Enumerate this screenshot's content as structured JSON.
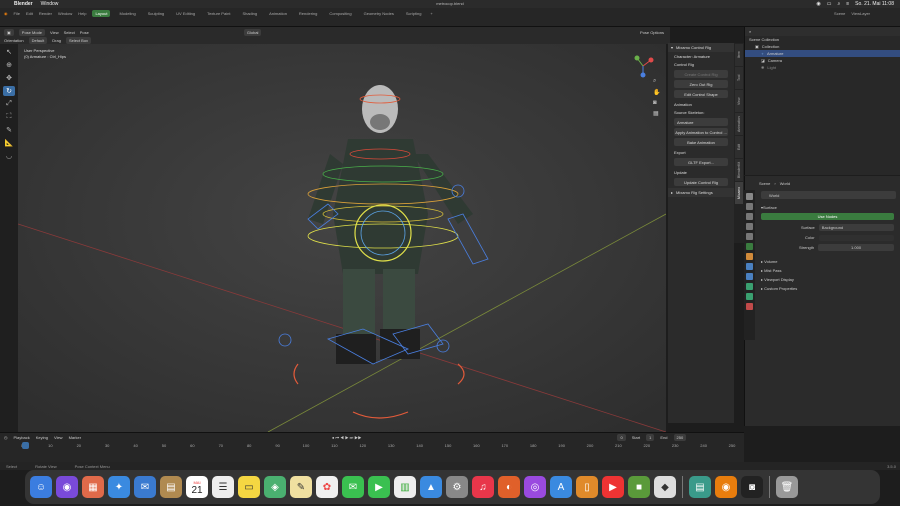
{
  "mac_menu": {
    "app": "Blender",
    "items": [
      "Window"
    ],
    "clock": "So. 21. Mai 11:08"
  },
  "file_title": "metrocop.blend",
  "topbar": {
    "menus": [
      "File",
      "Edit",
      "Render",
      "Window",
      "Help"
    ],
    "workspaces": [
      "Layout",
      "Modeling",
      "Sculpting",
      "UV Editing",
      "Texture Paint",
      "Shading",
      "Animation",
      "Rendering",
      "Compositing",
      "Geometry Nodes",
      "Scripting"
    ],
    "active_workspace": "Layout",
    "scene": "Scene",
    "view_layer": "ViewLayer"
  },
  "viewport_header": {
    "mode": "Pose Mode",
    "menus": [
      "View",
      "Select",
      "Pose"
    ],
    "orientation_label": "Orientation",
    "orientation": "Default",
    "drag_label": "Drag",
    "drag": "Select Box",
    "transform": "Global",
    "pose_options": "Pose Options"
  },
  "viewport_info": {
    "line1": "User Perspective",
    "line2": "(0) Armature : Ctrl_Hips"
  },
  "npanel": {
    "title": "Mixamo Control Rig",
    "character": "Character: Armature",
    "control_rig": "Control Rig",
    "create_rig": "Create Control Rig",
    "zero_out": "Zero Out Rig",
    "edit_shape": "Edit Control Shape",
    "animation": "Animation",
    "source_label": "Source Skeleton:",
    "source": "Armature",
    "apply_anim": "Apply Animation to Control ...",
    "bake_anim": "Bake Animation",
    "export": "Export",
    "gltf": "GLTF Export...",
    "update": "Update",
    "update_rig": "Update Control Rig",
    "settings": "Mixamo Rig Settings"
  },
  "side_tabs": [
    "Item",
    "Tool",
    "View",
    "Animation",
    "Edit",
    "BlenderKit",
    "Mixamo"
  ],
  "outliner": {
    "header": "Scene Collection",
    "rows": [
      {
        "name": "Collection",
        "indent": 1
      },
      {
        "name": "Armature",
        "indent": 2,
        "selected": true
      },
      {
        "name": "Camera",
        "indent": 2
      },
      {
        "name": "Light",
        "indent": 2
      }
    ]
  },
  "properties": {
    "scene": "Scene",
    "world_crumb": "World",
    "world": "World",
    "section": "Surface",
    "use_nodes": "Use Nodes",
    "surface_label": "Surface",
    "surface_value": "Background",
    "color_label": "Color",
    "strength_label": "Strength",
    "strength_value": "1.000",
    "panels": [
      "Volume",
      "Mist Pass",
      "Viewport Display",
      "Custom Properties"
    ]
  },
  "timeline": {
    "menus": [
      "Playback",
      "Keying",
      "View",
      "Marker"
    ],
    "frame": "0",
    "start_label": "Start",
    "start": "1",
    "end_label": "End",
    "end": "250",
    "ticks": [
      "0",
      "10",
      "20",
      "30",
      "40",
      "50",
      "60",
      "70",
      "80",
      "90",
      "100",
      "110",
      "120",
      "130",
      "140",
      "150",
      "160",
      "170",
      "180",
      "190",
      "200",
      "210",
      "220",
      "230",
      "240",
      "250"
    ]
  },
  "statusbar": {
    "select": "Select",
    "rotate": "Rotate View",
    "menu": "Pose Context Menu",
    "version": "3.5.0"
  },
  "dock": {
    "calendar_month": "MAI",
    "calendar_day": "21"
  },
  "colors": {
    "accent_green": "#3a7c3f",
    "select_blue": "#334d80",
    "active_tool": "#3a6ea5"
  }
}
